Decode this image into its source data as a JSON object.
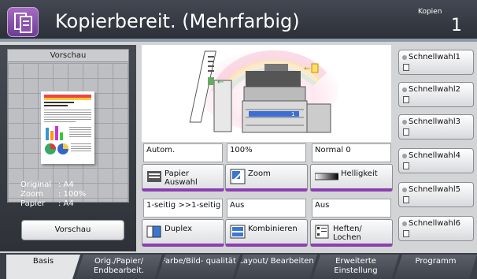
{
  "header": {
    "title": "Kopierbereit. (Mehrfarbig)",
    "copies_label": "Kopien",
    "copies_value": "1",
    "home_icon": "copy-mode-icon"
  },
  "preview": {
    "header": "Vorschau",
    "page_text": "The following items before the colour preview...",
    "original_label": "Original",
    "original_value": ": A4",
    "zoom_label": "Zoom",
    "zoom_value": ": 100%",
    "paper_label": "Papier",
    "paper_value": ": A4",
    "button": "Vorschau"
  },
  "functions": [
    {
      "value": "Autom.",
      "label": "Papier Auswahl",
      "icon": "paper-tray-icon"
    },
    {
      "value": "100%",
      "label": "Zoom",
      "icon": "zoom-icon"
    },
    {
      "value": "Normal 0",
      "label": "Helligkeit",
      "icon": "brightness-icon"
    },
    {
      "value": "1-seitig >>1-seitig",
      "label": "Duplex",
      "icon": "duplex-icon"
    },
    {
      "value": "Aus",
      "label": "Kombinieren",
      "icon": "combine-icon"
    },
    {
      "value": "Aus",
      "label": "Heften/ Lochen",
      "icon": "staple-punch-icon"
    }
  ],
  "quick_keys": [
    "Schnellwahl1",
    "Schnellwahl2",
    "Schnellwahl3",
    "Schnellwahl4",
    "Schnellwahl5",
    "Schnellwahl6"
  ],
  "tabs": [
    {
      "label": "Basis",
      "active": true
    },
    {
      "label": "Orig./Papier/ Endbearbeit.",
      "active": false
    },
    {
      "label": "Farbe/Bild- qualität",
      "active": false
    },
    {
      "label": "Layout/ Bearbeiten",
      "active": false
    },
    {
      "label": "Erweiterte Einstellung",
      "active": false
    },
    {
      "label": "Programm",
      "active": false
    }
  ],
  "colors": {
    "accent": "#8c3fb0",
    "header": "#3b3f47"
  }
}
